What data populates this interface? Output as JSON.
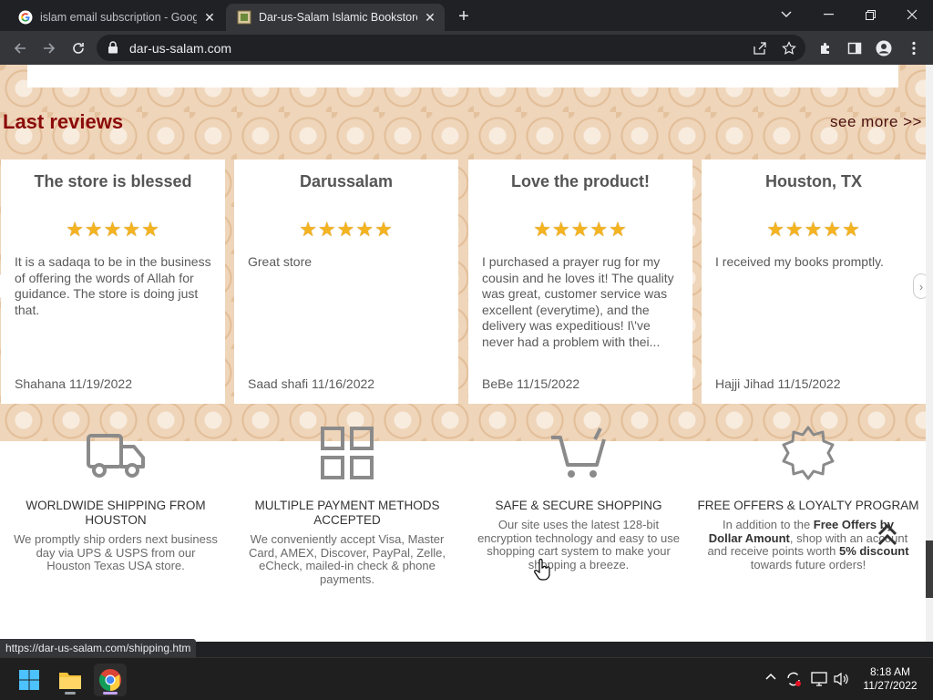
{
  "browser": {
    "tabs": [
      {
        "title": "islam email subscription - Google",
        "close": "✕"
      },
      {
        "title": "Dar-us-Salam Islamic Bookstore:",
        "close": "✕"
      }
    ],
    "new_tab": "+",
    "url": "dar-us-salam.com",
    "status_url": "https://dar-us-salam.com/shipping.htm"
  },
  "reviews": {
    "title": "Last reviews",
    "see_more": "see more >>",
    "stars": "★★★★★",
    "items": [
      {
        "title": "The store is blessed",
        "rating": 5,
        "body": "It is a sadaqa to be in the business of offering the words of Allah for guidance. The store is doing just that.",
        "footer": "Shahana 11/19/2022"
      },
      {
        "title": "Darussalam",
        "rating": 5,
        "body": "Great store",
        "footer": "Saad shafi 11/16/2022"
      },
      {
        "title": "Love the product!",
        "rating": 5,
        "body": "I purchased a prayer rug for my cousin and he loves it! The quality was great, customer service was excellent (everytime), and the delivery was expeditious! I\\'ve never had a problem with thei...",
        "footer": "BeBe 11/15/2022"
      },
      {
        "title": "Houston, TX",
        "rating": 5,
        "body": "I received my books promptly.",
        "footer": "Hajji Jihad 11/15/2022"
      }
    ]
  },
  "features": [
    {
      "icon": "truck-icon",
      "title": "WORLDWIDE SHIPPING FROM HOUSTON",
      "desc": "We promptly ship orders next business day via UPS & USPS from our Houston Texas USA store."
    },
    {
      "icon": "grid-icon",
      "title": "MULTIPLE PAYMENT METHODS ACCEPTED",
      "desc": "We conveniently accept Visa, Master Card, AMEX, Discover, PayPal, Zelle, eCheck, mailed-in check & phone payments."
    },
    {
      "icon": "cart-icon",
      "title": "SAFE & SECURE SHOPPING",
      "desc": "Our site uses the latest 128-bit encryption technology and easy to use shopping cart system to make your shopping a breeze."
    },
    {
      "icon": "badge-icon",
      "title": "FREE OFFERS & LOYALTY PROGRAM",
      "desc_parts": [
        "In addition to the ",
        "Free Offers by Dollar Amount",
        ", shop with an account and receive points worth ",
        "5% discount",
        " towards future orders!"
      ]
    }
  ],
  "taskbar": {
    "time": "8:18 AM",
    "date": "11/27/2022"
  },
  "colors": {
    "reviews_title": "#8b0a0a",
    "star": "#f4b320",
    "pattern_bg": "#efd5b9"
  }
}
